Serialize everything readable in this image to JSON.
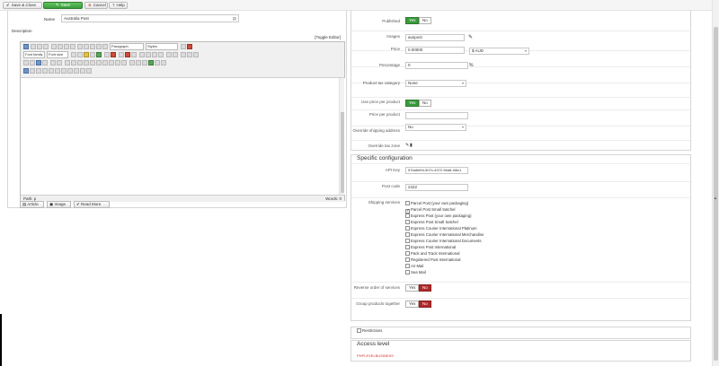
{
  "toolbar": {
    "save_close": "Save & Close",
    "save": "Save",
    "cancel": "Cancel",
    "help": "Help"
  },
  "left": {
    "name_label": "Name",
    "name_value": "Australia Post",
    "description_label": "Description",
    "toggle_editor": "[Toggle Editor]",
    "format_select": "Paragraph",
    "styles_select": "Styles",
    "font_family_select": "Font family",
    "font_size_select": "Font size",
    "path": "Path: p",
    "words": "Words: 0",
    "buttons": {
      "article": "Article",
      "image": "Image",
      "readmore": "Read More"
    }
  },
  "right": {
    "published_label": "Published",
    "yes": "Yes",
    "no": "No",
    "images_label": "Images",
    "images_value": "auspost",
    "price_label": "Price",
    "price_value": "0.00000",
    "currency_value": "$ AUD",
    "percentage_label": "Percentage",
    "percentage_value": "0",
    "percent_symbol": "%",
    "tax_category_label": "Product tax category",
    "tax_category_value": "None",
    "use_price_label": "Use price per product",
    "price_per_product_label": "Price per product",
    "override_shipping_label": "Override shipping address",
    "override_shipping_value": "No",
    "override_tax_label": "Override tax zone",
    "specific_legend": "Specific configuration",
    "api_key_label": "API Key",
    "api_key_value": "57ba6d94-507c-4372-9ba8-f46c1",
    "post_code_label": "Post code",
    "post_code_value": "2422",
    "shipping_services_label": "Shipping services",
    "services": [
      "Parcel Post (your own packaging)",
      "Parcel Post Small Satchel",
      "Express Post (your own packaging)",
      "Express Post Small Satchel",
      "Express Courier International Platinum",
      "Express Courier International Merchandise",
      "Express Courier International Documents",
      "Express Post International",
      "Pack and Track International",
      "Registered Post International",
      "Air Mail",
      "Sea Mail"
    ],
    "reverse_order_label": "Reverse order of services",
    "group_products_label": "Group products together",
    "restrictions_label": "Restrictions",
    "access_legend": "Access level",
    "access_value": "PHPLEVELBUSINESS"
  },
  "colors": {
    "green": "#3a9a3a",
    "red": "#b02a2a",
    "access_red": "#d32f2f"
  }
}
